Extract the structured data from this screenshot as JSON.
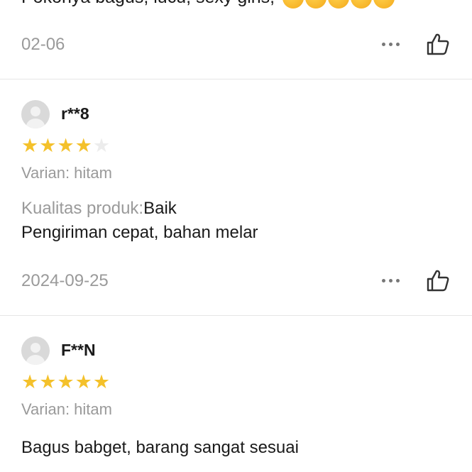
{
  "reviews_partial_top": {
    "text": "Pokonya bagus, lucu, sexy girls,",
    "emoji_icon": "smiling-face-with-hearts-emoji",
    "emoji_count": 5,
    "date": "02-06"
  },
  "reviews": [
    {
      "username": "r**8",
      "rating": 4,
      "max_rating": 5,
      "variant": "Varian: hitam",
      "quality_label": "Kualitas produk:",
      "quality_value": "Baik",
      "text": "Pengiriman cepat, bahan melar",
      "date": "2024-09-25"
    },
    {
      "username": "F**N",
      "rating": 5,
      "max_rating": 5,
      "variant": "Varian: hitam",
      "text": "Bagus babget, barang sangat sesuai"
    }
  ],
  "colors": {
    "star": "#f4c12b",
    "star_empty": "#ececec",
    "muted_text": "#9a9a9a",
    "divider": "#e6e6e6"
  },
  "icons": {
    "more": "more-dots-icon",
    "like": "thumbs-up-icon",
    "avatar": "default-avatar-icon"
  }
}
